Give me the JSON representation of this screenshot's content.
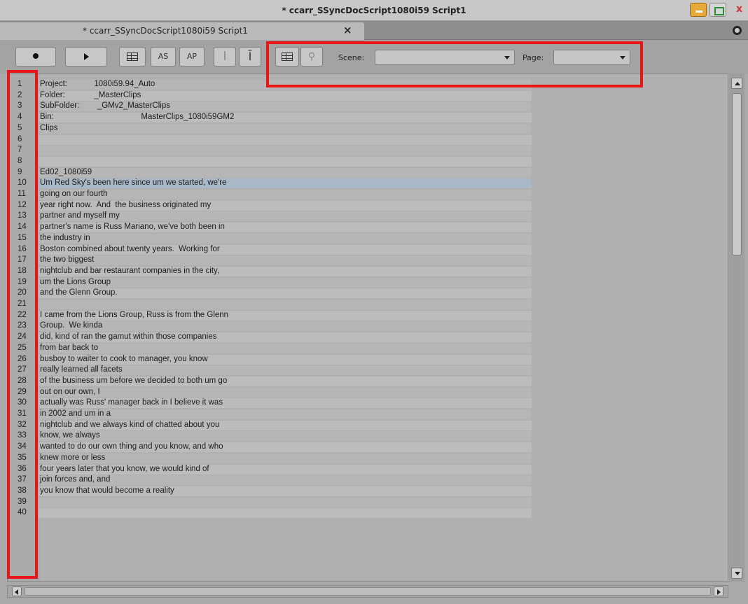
{
  "window": {
    "title": "* ccarr_SSyncDocScript1080i59 Script1",
    "close_label": "x"
  },
  "tab": {
    "label": "* ccarr_SSyncDocScript1080i59 Script1",
    "close_label": "×"
  },
  "toolbar": {
    "as_label": "AS",
    "ap_label": "AP",
    "cursor_label": "I",
    "insert_label": "Ī",
    "scene_label": "Scene:",
    "scene_value": "",
    "page_label": "Page:",
    "page_value": ""
  },
  "annotations": {
    "color": "#e8151b"
  },
  "script": {
    "lines": [
      {
        "n": "1",
        "text": "Project:            1080i59.94_Auto"
      },
      {
        "n": "2",
        "text": "Folder:             _MasterClips"
      },
      {
        "n": "3",
        "text": "SubFolder:        _GMv2_MasterClips"
      },
      {
        "n": "4",
        "text": "Bin:                                       MasterClips_1080i59GM2"
      },
      {
        "n": "5",
        "text": "Clips"
      },
      {
        "n": "6",
        "text": ""
      },
      {
        "n": "7",
        "text": ""
      },
      {
        "n": "8",
        "text": ""
      },
      {
        "n": "9",
        "text": "Ed02_1080i59"
      },
      {
        "n": "10",
        "text": "Um Red Sky's been here since um we started, we're"
      },
      {
        "n": "11",
        "text": "going on our fourth"
      },
      {
        "n": "12",
        "text": "year right now.  And  the business originated my"
      },
      {
        "n": "13",
        "text": "partner and myself my"
      },
      {
        "n": "14",
        "text": "partner's name is Russ Mariano, we've both been in"
      },
      {
        "n": "15",
        "text": "the industry in"
      },
      {
        "n": "16",
        "text": "Boston combined about twenty years.  Working for"
      },
      {
        "n": "17",
        "text": "the two biggest"
      },
      {
        "n": "18",
        "text": "nightclub and bar restaurant companies in the city,"
      },
      {
        "n": "19",
        "text": "um the Lions Group"
      },
      {
        "n": "20",
        "text": "and the Glenn Group."
      },
      {
        "n": "21",
        "text": ""
      },
      {
        "n": "22",
        "text": "I came from the Lions Group, Russ is from the Glenn"
      },
      {
        "n": "23",
        "text": "Group.  We kinda"
      },
      {
        "n": "24",
        "text": "did, kind of ran the gamut within those companies"
      },
      {
        "n": "25",
        "text": "from bar back to"
      },
      {
        "n": "26",
        "text": "busboy to waiter to cook to manager, you know"
      },
      {
        "n": "27",
        "text": "really learned all facets"
      },
      {
        "n": "28",
        "text": "of the business um before we decided to both um go"
      },
      {
        "n": "29",
        "text": "out on our own, I"
      },
      {
        "n": "30",
        "text": "actually was Russ' manager back in I believe it was"
      },
      {
        "n": "31",
        "text": "in 2002 and um in a"
      },
      {
        "n": "32",
        "text": "nightclub and we always kind of chatted about you"
      },
      {
        "n": "33",
        "text": "know, we always"
      },
      {
        "n": "34",
        "text": "wanted to do our own thing and you know, and who"
      },
      {
        "n": "35",
        "text": "knew more or less"
      },
      {
        "n": "36",
        "text": "four years later that you know, we would kind of"
      },
      {
        "n": "37",
        "text": "join forces and, and"
      },
      {
        "n": "38",
        "text": "you know that would become a reality"
      },
      {
        "n": "39",
        "text": ""
      },
      {
        "n": "40",
        "text": ""
      }
    ],
    "selected_line": "10"
  }
}
